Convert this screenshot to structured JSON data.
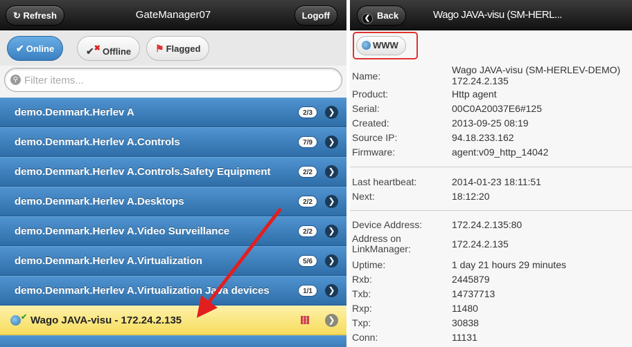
{
  "left": {
    "header": {
      "refresh_label": "Refresh",
      "title": "GateManager07",
      "logoff_label": "Logoff"
    },
    "filters": [
      {
        "label": "Online",
        "icon": "check-icon",
        "active": true
      },
      {
        "label": "Offline",
        "icon": "offline-x-icon",
        "active": false
      },
      {
        "label": "Flagged",
        "icon": "flag-icon",
        "active": false
      }
    ],
    "search": {
      "placeholder": "Filter items..."
    },
    "items": [
      {
        "label": "demo.Denmark.Herlev A",
        "count": "2/3"
      },
      {
        "label": "demo.Denmark.Herlev A.Controls",
        "count": "7/9"
      },
      {
        "label": "demo.Denmark.Herlev A.Controls.Safety Equipment",
        "count": "2/2"
      },
      {
        "label": "demo.Denmark.Herlev A.Desktops",
        "count": "2/2"
      },
      {
        "label": "demo.Denmark.Herlev A.Video Surveillance",
        "count": "2/2"
      },
      {
        "label": "demo.Denmark.Herlev A.Virtualization",
        "count": "5/6"
      },
      {
        "label": "demo.Denmark.Herlev A.Virtualization Java devices",
        "count": "1/1"
      }
    ],
    "selected_item": {
      "label": "Wago JAVA-visu - 172.24.2.135"
    }
  },
  "right": {
    "header": {
      "back_label": "Back",
      "title": "Wago JAVA-visu (SM-HERL..."
    },
    "www_label": "WWW",
    "group1": [
      {
        "key": "Name:",
        "value": "Wago JAVA-visu (SM-HERLEV-DEMO)",
        "value2": "172.24.2.135"
      },
      {
        "key": "Product:",
        "value": "Http agent"
      },
      {
        "key": "Serial:",
        "value": "00C0A20037E6#125"
      },
      {
        "key": "Created:",
        "value": "2013-09-25 08:19"
      },
      {
        "key": "Source IP:",
        "value": "94.18.233.162"
      },
      {
        "key": "Firmware:",
        "value": "agent:v09_http_14042"
      }
    ],
    "group2": [
      {
        "key": "Last heartbeat:",
        "value": "2014-01-23 18:11:51"
      },
      {
        "key": "Next:",
        "value": "18:12:20"
      }
    ],
    "group3": [
      {
        "key": "Device Address:",
        "value": "172.24.2.135:80"
      },
      {
        "key": "Address on",
        "key2": "LinkManager:",
        "value": "172.24.2.135"
      },
      {
        "key": "Uptime:",
        "value": "1 day 21 hours 29 minutes"
      },
      {
        "key": "Rxb:",
        "value": "2445879"
      },
      {
        "key": "Txb:",
        "value": "14737713"
      },
      {
        "key": "Rxp:",
        "value": "11480"
      },
      {
        "key": "Txp:",
        "value": "30838"
      },
      {
        "key": "Conn:",
        "value": "11131"
      }
    ]
  }
}
